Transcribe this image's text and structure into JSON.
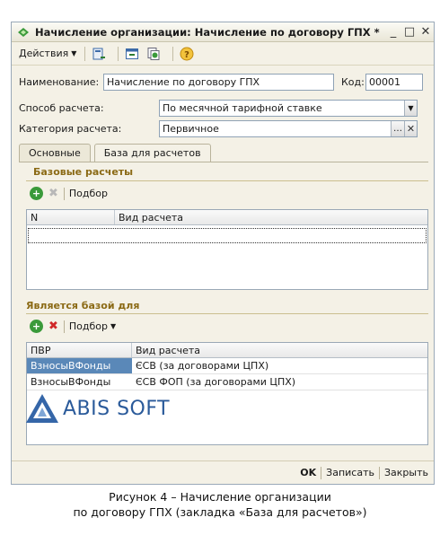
{
  "window": {
    "title": "Начисление организации: Начисление по договору ГПХ *"
  },
  "toolbar": {
    "actions_label": "Действия"
  },
  "form": {
    "name_label": "Наименование:",
    "name_value": "Начисление по договору ГПХ",
    "code_label": "Код:",
    "code_value": "00001",
    "calc_method_label": "Способ расчета:",
    "calc_method_value": "По месячной тарифной ставке",
    "category_label": "Категория расчета:",
    "category_value": "Первичное"
  },
  "tabs": [
    {
      "label": "Основные",
      "active": false
    },
    {
      "label": "База для расчетов",
      "active": true
    }
  ],
  "base_section": {
    "title": "Базовые расчеты",
    "select_label": "Подбор",
    "columns": [
      "N",
      "Вид расчета"
    ],
    "rows": []
  },
  "is_base_section": {
    "title": "Является базой для",
    "select_label": "Подбор",
    "columns": [
      "ПВР",
      "Вид расчета"
    ],
    "rows": [
      {
        "pvr": "ВзносыВФонды",
        "calc": "ЄСВ (за договорами ЦПХ)",
        "selected": true
      },
      {
        "pvr": "ВзносыВФонды",
        "calc": "ЄСВ ФОП (за договорами ЦПХ)",
        "selected": false
      }
    ]
  },
  "statusbar": {
    "ok": "OK",
    "save": "Записать",
    "close": "Закрыть"
  },
  "logo": {
    "text": "ABIS SOFT"
  },
  "caption": {
    "line1": "Рисунок 4 – Начисление организации",
    "line2": "по договору ГПХ (закладка «База для расчетов»)"
  }
}
